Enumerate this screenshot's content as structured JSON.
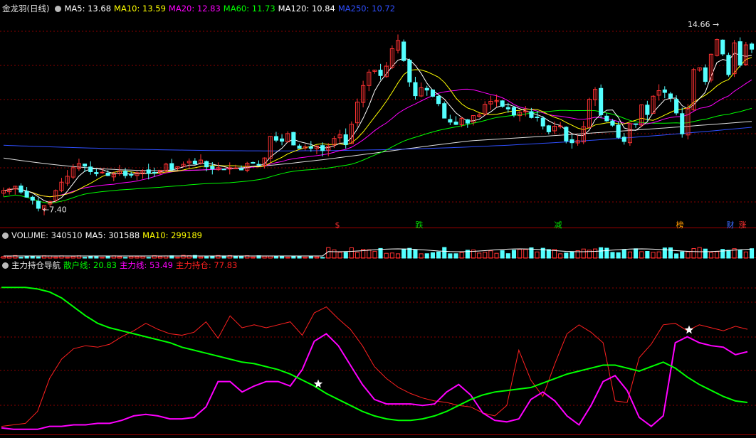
{
  "top_panel": {
    "title": "金龙羽(日线)",
    "indicators": [
      {
        "label": "MA5: 13.68",
        "color": "#ffffff"
      },
      {
        "label": "MA10: 13.59",
        "color": "#ffff00"
      },
      {
        "label": "MA20: 12.83",
        "color": "#ff00ff"
      },
      {
        "label": "MA60: 11.73",
        "color": "#00ff00"
      },
      {
        "label": "MA120: 10.84",
        "color": "#ffffff"
      },
      {
        "label": "MA250: 10.72",
        "color": "#2f4fff"
      }
    ],
    "high_label": "14.66",
    "low_label": "7.40",
    "event_markers": [
      {
        "text": "$",
        "color": "#ff3030"
      },
      {
        "text": "跌",
        "color": "#00e000"
      },
      {
        "text": "减",
        "color": "#00e000"
      },
      {
        "text": "榜",
        "color": "#ff9900"
      },
      {
        "text": "财",
        "color": "#3a6bff"
      },
      {
        "text": "涨",
        "color": "#ff3030"
      }
    ]
  },
  "volume_panel": {
    "title": "VOLUME: 340510",
    "indicators": [
      {
        "label": "MA5: 301588",
        "color": "#ffffff"
      },
      {
        "label": "MA10: 299189",
        "color": "#ffff00"
      }
    ]
  },
  "indicator_panel": {
    "title": "主力持仓导航",
    "indicators": [
      {
        "label": "散户线: 20.83",
        "color": "#00ff00"
      },
      {
        "label": "主力线: 53.49",
        "color": "#ff00ff"
      },
      {
        "label": "主力持仓: 77.83",
        "color": "#ff2020"
      }
    ]
  },
  "chart_data": [
    {
      "type": "candlestick",
      "title": "金龙羽(日线)",
      "ylim": [
        7.0,
        15.0
      ],
      "close": [
        8.12,
        8.18,
        8.29,
        8.06,
        7.86,
        7.74,
        7.42,
        7.53,
        7.69,
        8.12,
        8.45,
        8.68,
        9.02,
        9.18,
        9.08,
        8.86,
        8.78,
        8.84,
        8.71,
        8.76,
        8.89,
        8.71,
        8.74,
        8.82,
        8.89,
        8.79,
        8.82,
        8.92,
        9.16,
        8.95,
        9.06,
        9.15,
        9.27,
        9.17,
        9.32,
        9.05,
        8.97,
        9.02,
        8.96,
        9.02,
        9.01,
        8.93,
        9.19,
        9.21,
        9.12,
        9.4,
        10.25,
        10.1,
        10.06,
        10.36,
        9.91,
        9.78,
        9.84,
        9.78,
        9.87,
        9.69,
        9.87,
        10.17,
        10.31,
        9.93,
        10.73,
        11.6,
        12.25,
        12.78,
        12.86,
        12.64,
        13.01,
        13.7,
        14.02,
        13.23,
        12.39,
        11.85,
        12.16,
        12.07,
        11.83,
        11.54,
        10.97,
        10.81,
        10.72,
        10.96,
        10.77,
        11.07,
        11.09,
        11.51,
        11.63,
        11.66,
        11.43,
        11.33,
        11.09,
        11.2,
        11.25,
        10.99,
        10.99,
        10.66,
        10.43,
        10.65,
        10.66,
        10.07,
        10.0,
        10.08,
        10.63,
        11.71,
        12.1,
        11.1,
        10.86,
        10.69,
        10.21,
        10.05,
        10.75,
        10.74,
        11.49,
        11.11,
        11.83,
        12.05,
        11.98,
        11.76,
        11.17,
        10.35,
        11.35,
        12.88,
        12.95,
        12.41,
        13.48,
        14.06,
        13.49,
        12.68,
        13.93,
        13.05,
        13.85,
        13.68
      ],
      "ma": {
        "MA5": 13.68,
        "MA10": 13.59,
        "MA20": 12.83,
        "MA60": 11.73,
        "MA120": 10.84,
        "MA250": 10.72
      },
      "annotations": [
        {
          "text": "14.66",
          "price": 14.66
        },
        {
          "text": "7.40",
          "price": 7.4
        }
      ]
    },
    {
      "type": "bar",
      "title": "VOLUME",
      "last_value": 340510,
      "ma": {
        "MA5": 301588,
        "MA10": 299189
      }
    },
    {
      "type": "line",
      "title": "主力持仓导航",
      "ylim": [
        0,
        100
      ],
      "series": [
        {
          "name": "散户线",
          "color": "#00ff00",
          "values": [
            97,
            97,
            97,
            96,
            94,
            90,
            84,
            78,
            73,
            70,
            68,
            66,
            64,
            62,
            60,
            57,
            55,
            53,
            51,
            49,
            47,
            46,
            44,
            42,
            39,
            35,
            31,
            26,
            22,
            18,
            14,
            11,
            9,
            8,
            8,
            9,
            11,
            14,
            18,
            22,
            25,
            27,
            28,
            29,
            30,
            33,
            36,
            39,
            41,
            43,
            45,
            45,
            43,
            41,
            44,
            47,
            43,
            37,
            32,
            28,
            24,
            21,
            20
          ]
        },
        {
          "name": "主力线",
          "color": "#ff00ff",
          "values": [
            3,
            2,
            2,
            2,
            4,
            4,
            5,
            5,
            6,
            6,
            8,
            11,
            12,
            11,
            9,
            9,
            10,
            17,
            34,
            34,
            27,
            31,
            34,
            34,
            31,
            42,
            61,
            66,
            58,
            45,
            32,
            22,
            19,
            19,
            19,
            18,
            19,
            27,
            32,
            25,
            13,
            8,
            7,
            9,
            22,
            27,
            21,
            11,
            5,
            18,
            34,
            38,
            28,
            10,
            4,
            11,
            60,
            64,
            60,
            58,
            57,
            52,
            54
          ]
        },
        {
          "name": "主力持仓",
          "color": "#ff2020",
          "values": [
            4,
            5,
            6,
            14,
            36,
            49,
            56,
            58,
            57,
            59,
            64,
            68,
            73,
            69,
            66,
            65,
            67,
            74,
            63,
            78,
            70,
            72,
            70,
            72,
            74,
            65,
            80,
            84,
            76,
            69,
            58,
            44,
            36,
            30,
            26,
            23,
            21,
            20,
            18,
            17,
            13,
            11,
            18,
            55,
            35,
            24,
            46,
            66,
            72,
            67,
            60,
            21,
            20,
            50,
            59,
            72,
            73,
            68,
            72,
            70,
            68,
            71,
            69
          ]
        }
      ]
    }
  ]
}
